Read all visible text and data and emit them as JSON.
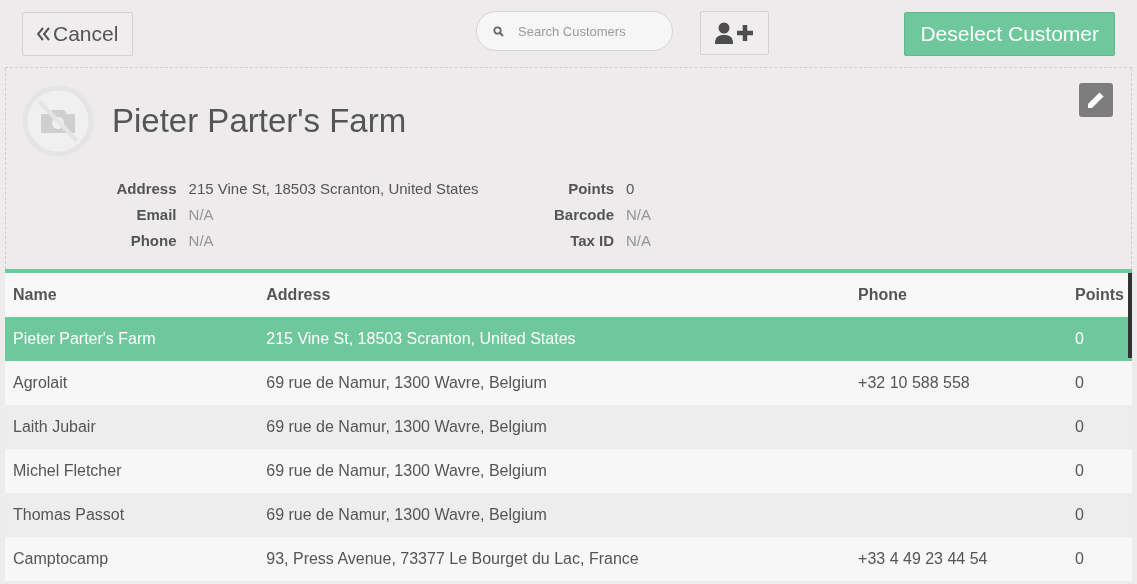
{
  "toolbar": {
    "cancel_label": "Cancel",
    "search": {
      "placeholder": "Search Customers"
    },
    "deselect_label": "Deselect Customer"
  },
  "customer": {
    "name": "Pieter Parter's Farm",
    "fields_left": [
      {
        "label": "Address",
        "value": "215 Vine St, 18503 Scranton, United States",
        "empty": false
      },
      {
        "label": "Email",
        "value": "N/A",
        "empty": true
      },
      {
        "label": "Phone",
        "value": "N/A",
        "empty": true
      }
    ],
    "fields_right": [
      {
        "label": "Points",
        "value": "0",
        "empty": false
      },
      {
        "label": "Barcode",
        "value": "N/A",
        "empty": true
      },
      {
        "label": "Tax ID",
        "value": "N/A",
        "empty": true
      }
    ]
  },
  "table": {
    "columns": [
      "Name",
      "Address",
      "Phone",
      "Points"
    ],
    "rows": [
      {
        "name": "Pieter Parter's Farm",
        "address": "215 Vine St, 18503 Scranton, United States",
        "phone": "",
        "points": "0",
        "selected": true
      },
      {
        "name": "Agrolait",
        "address": "69 rue de Namur, 1300 Wavre, Belgium",
        "phone": "+32 10 588 558",
        "points": "0",
        "selected": false
      },
      {
        "name": "Laith Jubair",
        "address": "69 rue de Namur, 1300 Wavre, Belgium",
        "phone": "",
        "points": "0",
        "selected": false
      },
      {
        "name": "Michel Fletcher",
        "address": "69 rue de Namur, 1300 Wavre, Belgium",
        "phone": "",
        "points": "0",
        "selected": false
      },
      {
        "name": "Thomas Passot",
        "address": "69 rue de Namur, 1300 Wavre, Belgium",
        "phone": "",
        "points": "0",
        "selected": false
      },
      {
        "name": "Camptocamp",
        "address": "93, Press Avenue, 73377 Le Bourget du Lac, France",
        "phone": "+33 4 49 23 44 54",
        "points": "0",
        "selected": false
      }
    ]
  }
}
